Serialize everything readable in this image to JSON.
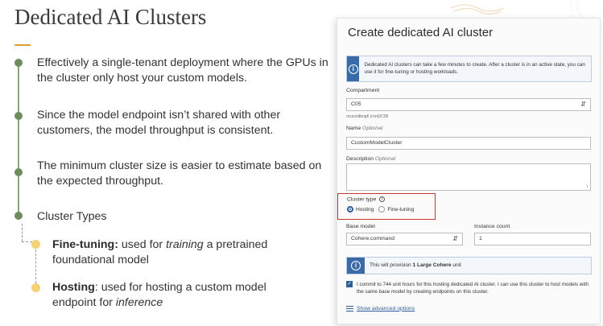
{
  "slide": {
    "title": "Dedicated AI Clusters",
    "bullets": [
      "Effectively a single-tenant deployment where the GPUs in the cluster only host your custom models.",
      "Since the model endpoint isn’t shared with other customers, the model throughput is consistent.",
      "The minimum cluster size is easier to estimate based on the expected throughput.",
      "Cluster Types"
    ],
    "sub_bullets": [
      {
        "term": "Fine-tuning:",
        "before": " used for ",
        "em": "training",
        "after": " a pretrained foundational model"
      },
      {
        "term": "Hosting",
        "before": ": used for hosting a custom model endpoint for ",
        "em": "inference",
        "after": ""
      }
    ]
  },
  "dialog": {
    "title": "Create dedicated AI cluster",
    "info_text": "Dedicated AI clusters can take a few minutes to create. After a cluster is in an active state, you can use it for fine-tuning or hosting workloads.",
    "compartment_label": "Compartment",
    "compartment_value": "C05",
    "compartment_path": "ocuocidbng6 (root)/C05",
    "name_label": "Name",
    "optional": "Optional",
    "name_value": "CustomModelCluster",
    "description_label": "Description",
    "cluster_type_label": "Cluster type",
    "cluster_types": [
      "Hosting",
      "Fine-tuning"
    ],
    "selected_cluster_type": "Hosting",
    "base_model_label": "Base model",
    "base_model_value": "Cohere.command",
    "instance_count_label": "Instance count",
    "instance_count_value": "1",
    "provision_prefix": "This will provision ",
    "provision_unit": "1 Large Cohere",
    "provision_suffix": " unit",
    "commit_text": "I commit to 744 unit hours for this hosting dedicated AI cluster. I can use this cluster to host models with the same base model by creating endpoints on this cluster.",
    "commit_checked": true,
    "advanced_link": "Show advanced options"
  },
  "colors": {
    "accent_green": "#6e8c5e",
    "accent_yellow": "#f4d27a",
    "info_blue": "#3a6aa8",
    "highlight_red": "#c0392b"
  }
}
